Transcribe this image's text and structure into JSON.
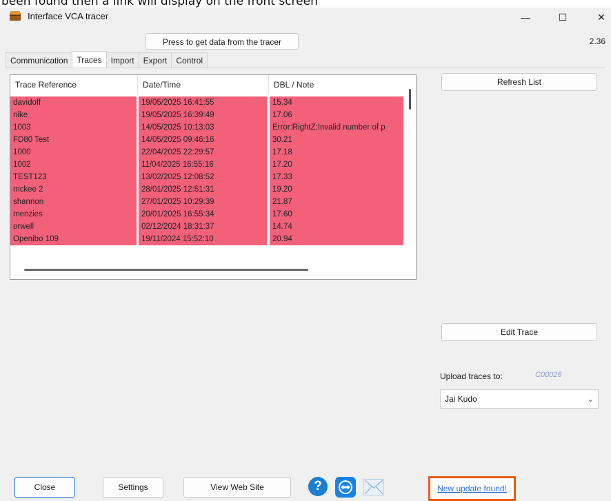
{
  "doc_caption": "been found then a link will display on the front screen",
  "window": {
    "title": "Interface VCA tracer",
    "minimize_glyph": "—",
    "maximize_glyph": "☐",
    "close_glyph": "✕"
  },
  "toolbar": {
    "get_data_label": "Press to get data from the tracer",
    "version": "2.36"
  },
  "tabs": [
    {
      "label": "Communication"
    },
    {
      "label": "Traces"
    },
    {
      "label": "Import"
    },
    {
      "label": "Export"
    },
    {
      "label": "Control"
    }
  ],
  "active_tab": "Traces",
  "traces_table": {
    "columns": [
      "Trace Reference",
      "Date/Time",
      "DBL / Note"
    ],
    "rows": [
      [
        "davidoff",
        "19/05/2025 16:41:55",
        "15.34"
      ],
      [
        "nike",
        "19/05/2025 16:39:49",
        "17.06"
      ],
      [
        "1003",
        "14/05/2025 10:13:03",
        "Error:RightZ:Invalid number of p"
      ],
      [
        "FD80 Test",
        "14/05/2025 09:46:16",
        "30.21"
      ],
      [
        "1000",
        "22/04/2025 22:29:57",
        "17.18"
      ],
      [
        "1002",
        "11/04/2025 16:55:16",
        "17.20"
      ],
      [
        "TEST123",
        "13/02/2025 12:08:52",
        "17.33"
      ],
      [
        "mckee 2",
        "28/01/2025 12:51:31",
        "19.20"
      ],
      [
        "shannon",
        "27/01/2025 10:29:39",
        "21.87"
      ],
      [
        "menzies",
        "20/01/2025 16:55:34",
        "17.60"
      ],
      [
        "orwell",
        "02/12/2024 18:31:37",
        "14.74"
      ],
      [
        "Openibo 109",
        "19/11/2024 15:52:10",
        "20.94"
      ]
    ]
  },
  "side_panel": {
    "refresh_label": "Refresh List",
    "edit_label": "Edit Trace",
    "upload_label": "Upload traces to:",
    "upload_code": "C00026",
    "upload_selected": "Jai Kudo"
  },
  "footer": {
    "close_label": "Close",
    "settings_label": "Settings",
    "website_label": "View Web Site",
    "help_glyph": "?",
    "update_label": "New update found!"
  },
  "colors": {
    "row_highlight": "#f2607a",
    "update_border": "#f05a15",
    "link": "#2c6ed4",
    "help_blue": "#1d7fd1"
  },
  "icons": [
    "app-icon",
    "help-icon",
    "teamviewer-icon",
    "mail-icon",
    "chevron-down-icon"
  ]
}
